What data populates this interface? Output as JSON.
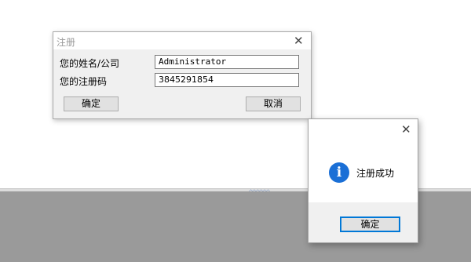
{
  "register_dialog": {
    "title": "注册",
    "name_label": "您的姓名/公司",
    "name_value": "Administrator",
    "code_label": "您的注册码",
    "code_value": "3845291854",
    "ok_label": "确定",
    "cancel_label": "取消",
    "close_glyph": "✕"
  },
  "message_box": {
    "icon": "info-icon",
    "icon_glyph": "i",
    "message": "注册成功",
    "ok_label": "确定",
    "close_glyph": "✕"
  },
  "background": {
    "splitter_glyph": "◇◇◇◇◇◇"
  },
  "colors": {
    "info_icon": "#1a6fd6",
    "button_focus": "#0078d7",
    "background_grey": "#9a9a9a"
  }
}
